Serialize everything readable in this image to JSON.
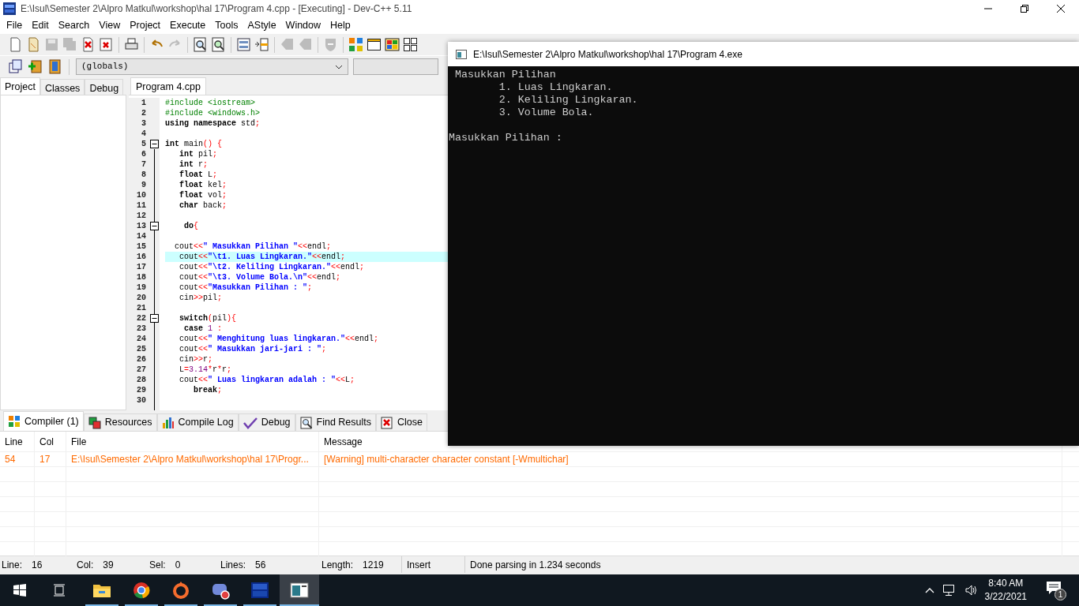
{
  "window": {
    "title": "E:\\Isul\\Semester 2\\Alpro Matkul\\workshop\\hal 17\\Program 4.cpp - [Executing] - Dev-C++ 5.11"
  },
  "menu": [
    "File",
    "Edit",
    "Search",
    "View",
    "Project",
    "Execute",
    "Tools",
    "AStyle",
    "Window",
    "Help"
  ],
  "toolbar": [
    {
      "kind": "new",
      "disabled": false
    },
    {
      "kind": "open",
      "disabled": false
    },
    {
      "kind": "save",
      "disabled": true
    },
    {
      "kind": "save-all",
      "disabled": true
    },
    {
      "kind": "close",
      "disabled": false
    },
    {
      "kind": "close-all",
      "disabled": false
    },
    {
      "kind": "sep"
    },
    {
      "kind": "print",
      "disabled": false
    },
    {
      "kind": "sep"
    },
    {
      "kind": "undo",
      "disabled": false
    },
    {
      "kind": "redo",
      "disabled": true
    },
    {
      "kind": "sep"
    },
    {
      "kind": "find",
      "disabled": false
    },
    {
      "kind": "replace",
      "disabled": false
    },
    {
      "kind": "sep"
    },
    {
      "kind": "list",
      "disabled": false
    },
    {
      "kind": "goto",
      "disabled": false
    },
    {
      "kind": "sep"
    },
    {
      "kind": "tag",
      "disabled": true
    },
    {
      "kind": "tag",
      "disabled": true
    },
    {
      "kind": "sep"
    },
    {
      "kind": "shield",
      "disabled": true
    },
    {
      "kind": "sep"
    },
    {
      "kind": "grid-color",
      "disabled": false
    },
    {
      "kind": "window",
      "disabled": false
    },
    {
      "kind": "tiles-color",
      "disabled": false
    },
    {
      "kind": "grid",
      "disabled": false
    }
  ],
  "scope_box": {
    "value": "(globals)"
  },
  "side_tabs": [
    {
      "label": "Project",
      "selected": true
    },
    {
      "label": "Classes",
      "selected": false
    },
    {
      "label": "Debug",
      "selected": false
    }
  ],
  "editor": {
    "tabs": [
      {
        "label": "Program 4.cpp",
        "selected": true
      }
    ],
    "lines": [
      {
        "number": "1",
        "fold": false,
        "current": false,
        "tokens": [
          {
            "kind": "pre",
            "text": "#include <iostream>"
          }
        ]
      },
      {
        "number": "2",
        "fold": false,
        "current": false,
        "tokens": [
          {
            "kind": "pre",
            "text": "#include <windows.h>"
          }
        ]
      },
      {
        "number": "3",
        "fold": false,
        "current": false,
        "tokens": [
          {
            "kind": "kw",
            "text": "using namespace"
          },
          {
            "kind": "id",
            "text": " std"
          },
          {
            "kind": "sym",
            "text": ";"
          }
        ]
      },
      {
        "number": "4",
        "fold": false,
        "current": false
      },
      {
        "number": "5",
        "fold": true,
        "current": false,
        "tokens": [
          {
            "kind": "kw",
            "text": "int"
          },
          {
            "kind": "id",
            "text": " main"
          },
          {
            "kind": "sym",
            "text": "()"
          },
          {
            "kind": "sym",
            "text": " {"
          }
        ]
      },
      {
        "number": "6",
        "fold": false,
        "current": false,
        "tokens": [
          {
            "kind": "kw",
            "text": "   int"
          },
          {
            "kind": "id",
            "text": " pil"
          },
          {
            "kind": "sym",
            "text": ";"
          }
        ]
      },
      {
        "number": "7",
        "fold": false,
        "current": false,
        "tokens": [
          {
            "kind": "kw",
            "text": "   int"
          },
          {
            "kind": "id",
            "text": " r"
          },
          {
            "kind": "sym",
            "text": ";"
          }
        ]
      },
      {
        "number": "8",
        "fold": false,
        "current": false,
        "tokens": [
          {
            "kind": "kw",
            "text": "   float"
          },
          {
            "kind": "id",
            "text": " L"
          },
          {
            "kind": "sym",
            "text": ";"
          }
        ]
      },
      {
        "number": "9",
        "fold": false,
        "current": false,
        "tokens": [
          {
            "kind": "kw",
            "text": "   float"
          },
          {
            "kind": "id",
            "text": " kel"
          },
          {
            "kind": "sym",
            "text": ";"
          }
        ]
      },
      {
        "number": "10",
        "fold": false,
        "current": false,
        "tokens": [
          {
            "kind": "kw",
            "text": "   float"
          },
          {
            "kind": "id",
            "text": " vol"
          },
          {
            "kind": "sym",
            "text": ";"
          }
        ]
      },
      {
        "number": "11",
        "fold": false,
        "current": false,
        "tokens": [
          {
            "kind": "kw",
            "text": "   char"
          },
          {
            "kind": "id",
            "text": " back"
          },
          {
            "kind": "sym",
            "text": ";"
          }
        ]
      },
      {
        "number": "12",
        "fold": false,
        "current": false
      },
      {
        "number": "13",
        "fold": true,
        "current": false,
        "tokens": [
          {
            "kind": "kw",
            "text": "    do"
          },
          {
            "kind": "sym",
            "text": "{"
          }
        ]
      },
      {
        "number": "14",
        "fold": false,
        "current": false
      },
      {
        "number": "15",
        "fold": false,
        "current": false,
        "tokens": [
          {
            "kind": "id",
            "text": "  cout"
          },
          {
            "kind": "sym",
            "text": "<<"
          },
          {
            "kind": "str",
            "text": "\" Masukkan Pilihan \""
          },
          {
            "kind": "sym",
            "text": "<<"
          },
          {
            "kind": "id",
            "text": "endl"
          },
          {
            "kind": "sym",
            "text": ";"
          }
        ]
      },
      {
        "number": "16",
        "fold": false,
        "current": true,
        "tokens": [
          {
            "kind": "id",
            "text": "   cout"
          },
          {
            "kind": "sym",
            "text": "<<"
          },
          {
            "kind": "str",
            "text": "\"\\t1. Luas Lingkaran.\""
          },
          {
            "kind": "sym",
            "text": "<<"
          },
          {
            "kind": "id",
            "text": "endl"
          },
          {
            "kind": "sym",
            "text": ";"
          }
        ]
      },
      {
        "number": "17",
        "fold": false,
        "current": false,
        "tokens": [
          {
            "kind": "id",
            "text": "   cout"
          },
          {
            "kind": "sym",
            "text": "<<"
          },
          {
            "kind": "str",
            "text": "\"\\t2. Keliling Lingkaran.\""
          },
          {
            "kind": "sym",
            "text": "<<"
          },
          {
            "kind": "id",
            "text": "endl"
          },
          {
            "kind": "sym",
            "text": ";"
          }
        ]
      },
      {
        "number": "18",
        "fold": false,
        "current": false,
        "tokens": [
          {
            "kind": "id",
            "text": "   cout"
          },
          {
            "kind": "sym",
            "text": "<<"
          },
          {
            "kind": "str",
            "text": "\"\\t3. Volume Bola.\\n\""
          },
          {
            "kind": "sym",
            "text": "<<"
          },
          {
            "kind": "id",
            "text": "endl"
          },
          {
            "kind": "sym",
            "text": ";"
          }
        ]
      },
      {
        "number": "19",
        "fold": false,
        "current": false,
        "tokens": [
          {
            "kind": "id",
            "text": "   cout"
          },
          {
            "kind": "sym",
            "text": "<<"
          },
          {
            "kind": "str",
            "text": "\"Masukkan Pilihan : \""
          },
          {
            "kind": "sym",
            "text": ";"
          }
        ]
      },
      {
        "number": "20",
        "fold": false,
        "current": false,
        "tokens": [
          {
            "kind": "id",
            "text": "   cin"
          },
          {
            "kind": "sym",
            "text": ">>"
          },
          {
            "kind": "id",
            "text": "pil"
          },
          {
            "kind": "sym",
            "text": ";"
          }
        ]
      },
      {
        "number": "21",
        "fold": false,
        "current": false
      },
      {
        "number": "22",
        "fold": true,
        "current": false,
        "tokens": [
          {
            "kind": "kw",
            "text": "   switch"
          },
          {
            "kind": "sym",
            "text": "("
          },
          {
            "kind": "id",
            "text": "pil"
          },
          {
            "kind": "sym",
            "text": "){"
          }
        ]
      },
      {
        "number": "23",
        "fold": false,
        "current": false,
        "tokens": [
          {
            "kind": "kw",
            "text": "    case"
          },
          {
            "kind": "num",
            "text": " 1"
          },
          {
            "kind": "sym",
            "text": " :"
          }
        ]
      },
      {
        "number": "24",
        "fold": false,
        "current": false,
        "tokens": [
          {
            "kind": "id",
            "text": "   cout"
          },
          {
            "kind": "sym",
            "text": "<<"
          },
          {
            "kind": "str",
            "text": "\" Menghitung luas lingkaran.\""
          },
          {
            "kind": "sym",
            "text": "<<"
          },
          {
            "kind": "id",
            "text": "endl"
          },
          {
            "kind": "sym",
            "text": ";"
          }
        ]
      },
      {
        "number": "25",
        "fold": false,
        "current": false,
        "tokens": [
          {
            "kind": "id",
            "text": "   cout"
          },
          {
            "kind": "sym",
            "text": "<<"
          },
          {
            "kind": "str",
            "text": "\" Masukkan jari-jari : \""
          },
          {
            "kind": "sym",
            "text": ";"
          }
        ]
      },
      {
        "number": "26",
        "fold": false,
        "current": false,
        "tokens": [
          {
            "kind": "id",
            "text": "   cin"
          },
          {
            "kind": "sym",
            "text": ">>"
          },
          {
            "kind": "id",
            "text": "r"
          },
          {
            "kind": "sym",
            "text": ";"
          }
        ]
      },
      {
        "number": "27",
        "fold": false,
        "current": false,
        "tokens": [
          {
            "kind": "id",
            "text": "   L"
          },
          {
            "kind": "sym",
            "text": "="
          },
          {
            "kind": "num",
            "text": "3.14"
          },
          {
            "kind": "sym",
            "text": "*"
          },
          {
            "kind": "id",
            "text": "r"
          },
          {
            "kind": "sym",
            "text": "*"
          },
          {
            "kind": "id",
            "text": "r"
          },
          {
            "kind": "sym",
            "text": ";"
          }
        ]
      },
      {
        "number": "28",
        "fold": false,
        "current": false,
        "tokens": [
          {
            "kind": "id",
            "text": "   cout"
          },
          {
            "kind": "sym",
            "text": "<<"
          },
          {
            "kind": "str",
            "text": "\" Luas lingkaran adalah : \""
          },
          {
            "kind": "sym",
            "text": "<<"
          },
          {
            "kind": "id",
            "text": "L"
          },
          {
            "kind": "sym",
            "text": ";"
          }
        ]
      },
      {
        "number": "29",
        "fold": false,
        "current": false,
        "tokens": [
          {
            "kind": "kw",
            "text": "      break"
          },
          {
            "kind": "sym",
            "text": ";"
          }
        ]
      },
      {
        "number": "30",
        "fold": false,
        "current": false
      }
    ]
  },
  "bottom_tabs": [
    {
      "label": "Compiler (1)",
      "kind": "compiler",
      "selected": true
    },
    {
      "label": "Resources",
      "kind": "resources",
      "selected": false
    },
    {
      "label": "Compile Log",
      "kind": "log",
      "selected": false
    },
    {
      "label": "Debug",
      "kind": "debug",
      "selected": false
    },
    {
      "label": "Find Results",
      "kind": "find",
      "selected": false
    },
    {
      "label": "Close",
      "kind": "close",
      "selected": false
    }
  ],
  "messages": {
    "columns": [
      "Line",
      "Col",
      "File",
      "Message"
    ],
    "rows": [
      {
        "color": "#ff6a00",
        "cells": [
          "54",
          "17",
          "E:\\Isul\\Semester 2\\Alpro Matkul\\workshop\\hal 17\\Progr...",
          "[Warning] multi-character character constant [-Wmultichar]"
        ]
      }
    ]
  },
  "status_bar": [
    {
      "label": "Line:",
      "value": "16"
    },
    {
      "label": "Col:",
      "value": "39"
    },
    {
      "label": "Sel:",
      "value": "0"
    },
    {
      "label": "Lines:",
      "value": "56"
    },
    {
      "label": "Length:",
      "value": "1219"
    },
    {
      "value": "Insert"
    },
    {
      "value": "Done parsing in 1.234 seconds"
    }
  ],
  "console": {
    "title": "E:\\Isul\\Semester 2\\Alpro Matkul\\workshop\\hal 17\\Program 4.exe",
    "lines": [
      {
        "text": " Masukkan Pilihan",
        "spaced": false
      },
      {
        "text": "\t1. Luas Lingkaran.",
        "spaced": false
      },
      {
        "text": "\t2. Keliling Lingkaran.",
        "spaced": false
      },
      {
        "text": "\t3. Volume Bola.",
        "spaced": false
      },
      {
        "text": "Masukkan Pilihan :",
        "spaced": true
      }
    ]
  },
  "taskbar": {
    "apps": [
      {
        "kind": "explorer",
        "active": false
      },
      {
        "kind": "chrome",
        "active": false
      },
      {
        "kind": "origin",
        "active": false
      },
      {
        "kind": "discord",
        "active": false
      },
      {
        "kind": "devcpp",
        "active": false
      },
      {
        "kind": "console",
        "active": true
      }
    ],
    "time": "8:40 AM",
    "date": "3/22/2021",
    "notifications": "1"
  }
}
